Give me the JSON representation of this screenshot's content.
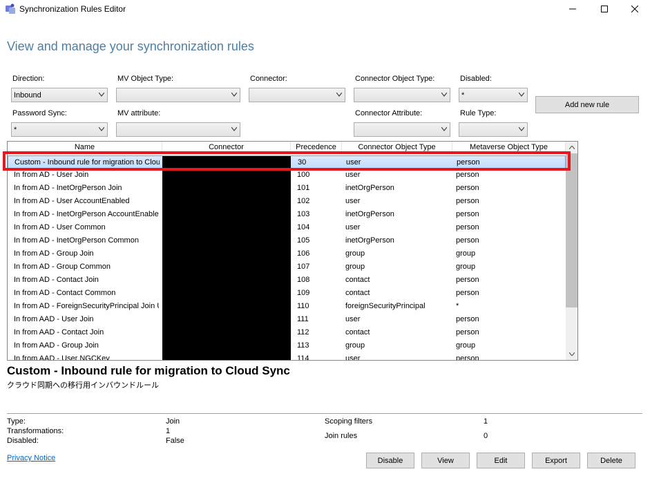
{
  "window": {
    "title": "Synchronization Rules Editor"
  },
  "headline": "View and manage your synchronization rules",
  "filters": {
    "direction": {
      "label": "Direction:",
      "value": "Inbound"
    },
    "mv_object_type": {
      "label": "MV Object Type:",
      "value": ""
    },
    "connector": {
      "label": "Connector:",
      "value": ""
    },
    "connector_object_type": {
      "label": "Connector Object Type:",
      "value": ""
    },
    "disabled": {
      "label": "Disabled:",
      "value": "*"
    },
    "password_sync": {
      "label": "Password Sync:",
      "value": "*"
    },
    "mv_attribute": {
      "label": "MV attribute:",
      "value": ""
    },
    "connector_attribute": {
      "label": "Connector Attribute:",
      "value": ""
    },
    "rule_type": {
      "label": "Rule Type:",
      "value": ""
    }
  },
  "add_rule_label": "Add new rule",
  "grid": {
    "columns": [
      "Name",
      "Connector",
      "Precedence",
      "Connector Object Type",
      "Metaverse Object Type"
    ],
    "rows": [
      {
        "name": "Custom - Inbound rule for migration to Cloud Sync",
        "precedence": "30",
        "cot": "user",
        "mot": "person"
      },
      {
        "name": "In from AD - User Join",
        "precedence": "100",
        "cot": "user",
        "mot": "person"
      },
      {
        "name": "In from AD - InetOrgPerson Join",
        "precedence": "101",
        "cot": "inetOrgPerson",
        "mot": "person"
      },
      {
        "name": "In from AD - User AccountEnabled",
        "precedence": "102",
        "cot": "user",
        "mot": "person"
      },
      {
        "name": "In from AD - InetOrgPerson AccountEnabled",
        "precedence": "103",
        "cot": "inetOrgPerson",
        "mot": "person"
      },
      {
        "name": "In from AD - User Common",
        "precedence": "104",
        "cot": "user",
        "mot": "person"
      },
      {
        "name": "In from AD - InetOrgPerson Common",
        "precedence": "105",
        "cot": "inetOrgPerson",
        "mot": "person"
      },
      {
        "name": "In from AD - Group Join",
        "precedence": "106",
        "cot": "group",
        "mot": "group"
      },
      {
        "name": "In from AD - Group Common",
        "precedence": "107",
        "cot": "group",
        "mot": "group"
      },
      {
        "name": "In from AD - Contact Join",
        "precedence": "108",
        "cot": "contact",
        "mot": "person"
      },
      {
        "name": "In from AD - Contact Common",
        "precedence": "109",
        "cot": "contact",
        "mot": "person"
      },
      {
        "name": "In from AD - ForeignSecurityPrincipal Join User",
        "precedence": "110",
        "cot": "foreignSecurityPrincipal",
        "mot": "*"
      },
      {
        "name": "In from AAD - User Join",
        "precedence": "111",
        "cot": "user",
        "mot": "person"
      },
      {
        "name": "In from AAD - Contact Join",
        "precedence": "112",
        "cot": "contact",
        "mot": "person"
      },
      {
        "name": "In from AAD - Group Join",
        "precedence": "113",
        "cot": "group",
        "mot": "group"
      },
      {
        "name": "In from AAD - User NGCKey",
        "precedence": "114",
        "cot": "user",
        "mot": "person"
      }
    ]
  },
  "details": {
    "title": "Custom - Inbound rule for migration to Cloud Sync",
    "description": "クラウド同期への移行用インバウンドルール",
    "type_label": "Type:",
    "type_value": "Join",
    "transformations_label": "Transformations:",
    "transformations_value": "1",
    "disabled_label": "Disabled:",
    "disabled_value": "False",
    "scoping_label": "Scoping filters",
    "scoping_value": "1",
    "join_label": "Join rules",
    "join_value": "0"
  },
  "privacy_notice": "Privacy Notice",
  "actions": {
    "disable": "Disable",
    "view": "View",
    "edit": "Edit",
    "export": "Export",
    "delete": "Delete"
  },
  "colors": {
    "headline": "#4a7fa8",
    "selection": "#c1dcfc",
    "highlight": "#e8171e"
  }
}
